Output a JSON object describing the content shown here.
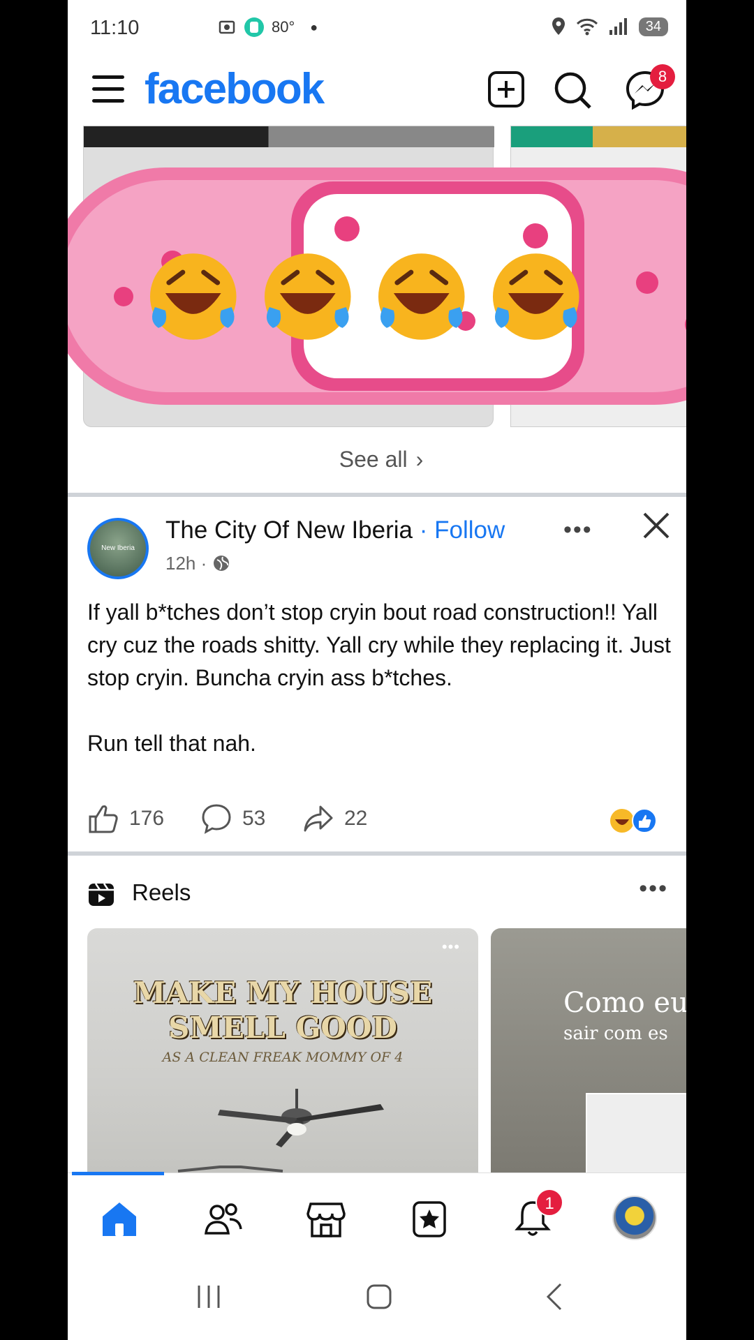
{
  "status_bar": {
    "time": "11:10",
    "temperature": "80°",
    "battery": "34"
  },
  "header": {
    "logo_text": "facebook",
    "messenger_badge": "8"
  },
  "carousel": {
    "see_all_label": "See all",
    "emoji_overlay": "🤣🤣🤣🤣"
  },
  "post": {
    "author": "The City Of New Iberia",
    "separator": " · ",
    "follow_label": "Follow",
    "time": "12h",
    "meta_separator": " · ",
    "avatar_text": "New Iberia",
    "text_paragraphs": [
      "If yall b*tches don’t stop cryin bout road construction!! Yall cry cuz the roads shitty. Yall cry while they replacing it. Just stop cryin. Buncha cryin ass b*tches.",
      "Run tell that nah."
    ],
    "likes": "176",
    "comments": "53",
    "shares": "22"
  },
  "reels": {
    "title": "Reels",
    "items": [
      {
        "title": "MAKE MY HOUSE SMELL GOOD",
        "subtitle": "AS A CLEAN FREAK MOMMY OF 4",
        "more": "•••"
      },
      {
        "title": "Como eu",
        "subtitle": "sair com es"
      }
    ]
  },
  "bottom_nav": {
    "notifications_badge": "1"
  },
  "colors": {
    "brand": "#1877f2",
    "badge": "#e41e3f"
  }
}
